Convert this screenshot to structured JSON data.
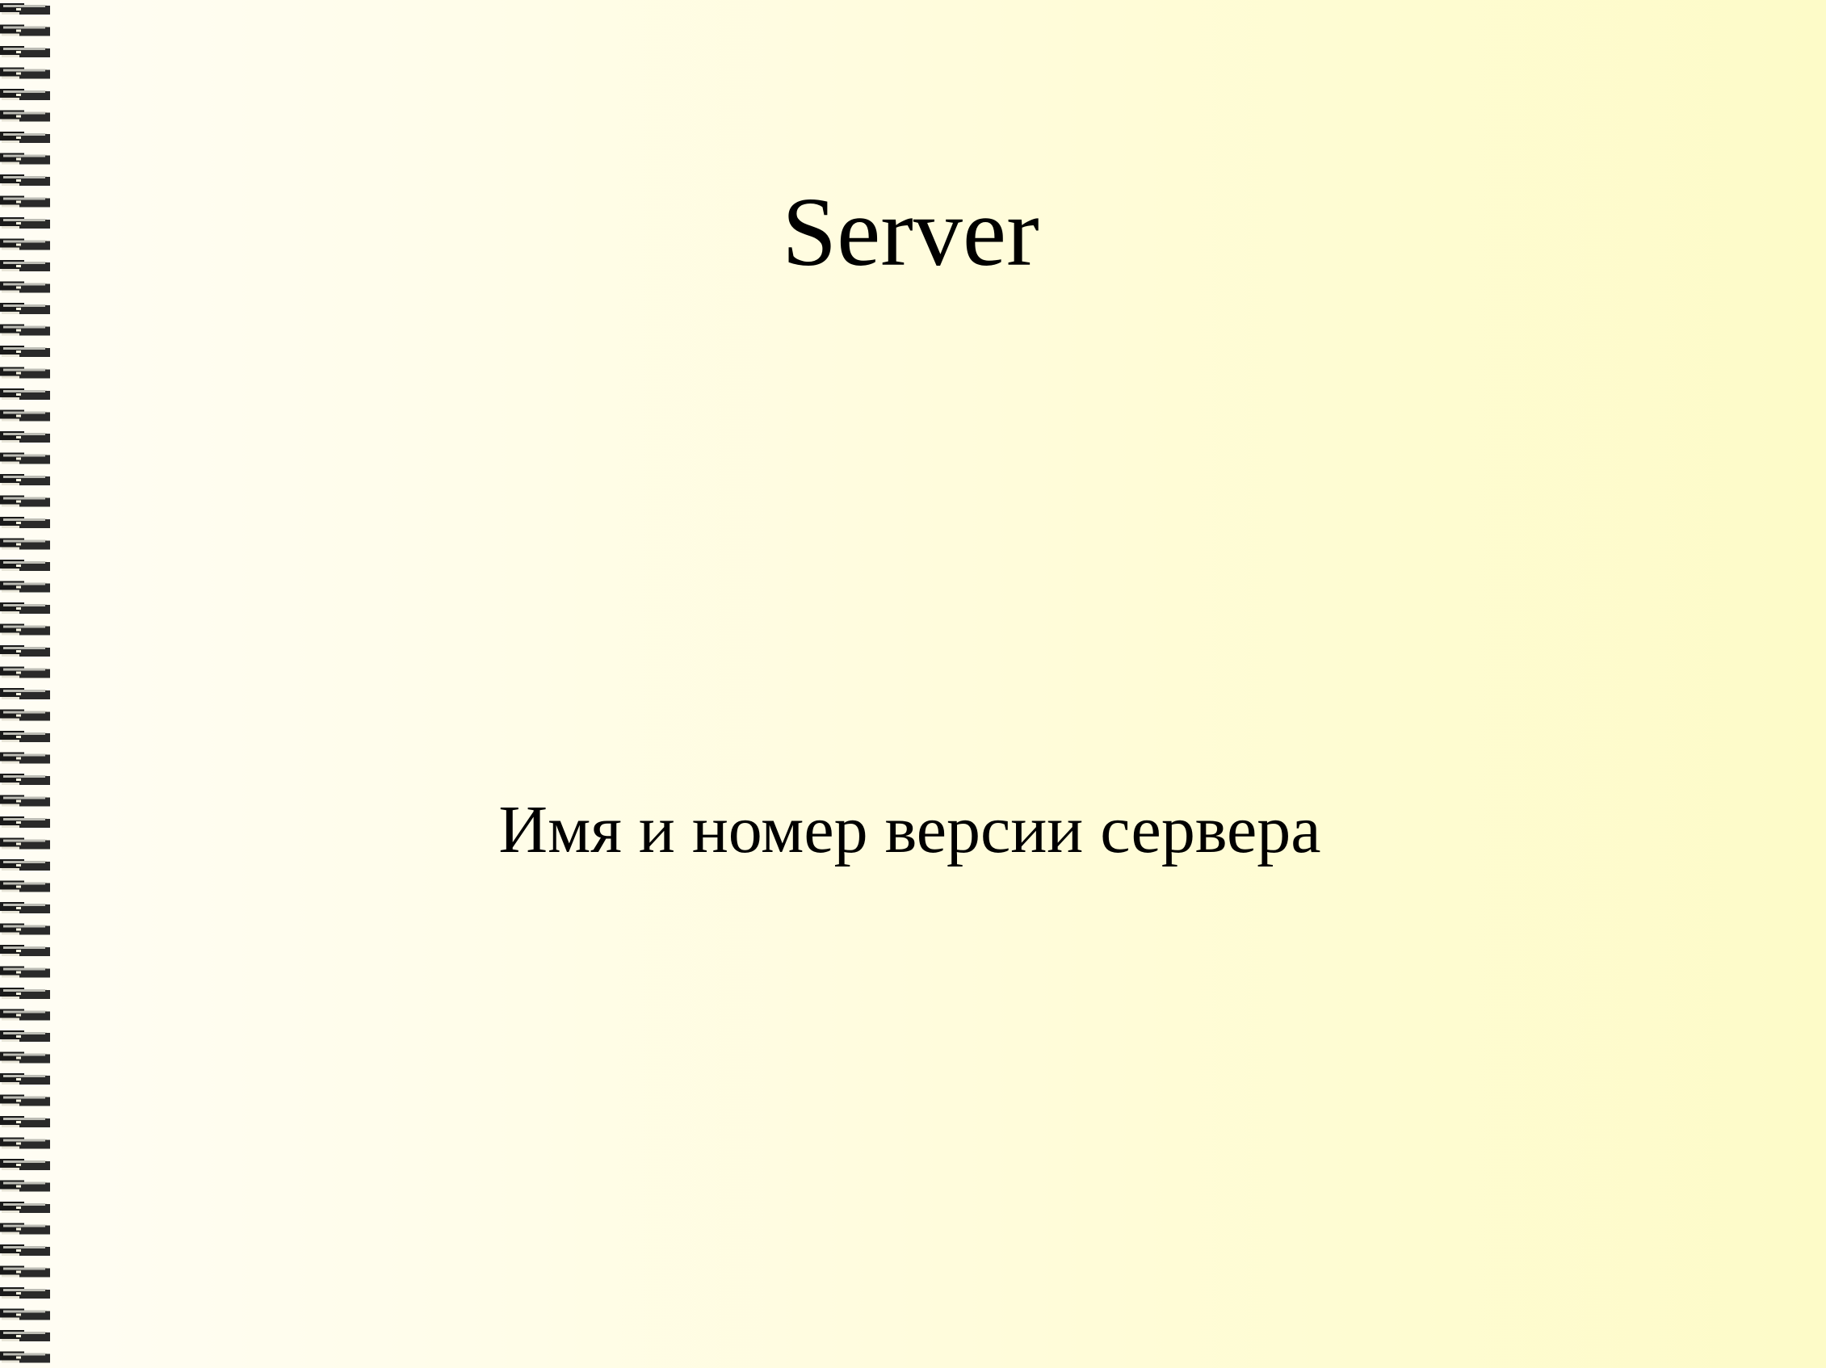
{
  "slide": {
    "title": "Server",
    "body": "Имя и номер версии сервера"
  },
  "theme": {
    "background_left": "#fffdf4",
    "background_right": "#fdfbc8",
    "text_color": "#000000",
    "binding_color": "#1a1a1a"
  }
}
